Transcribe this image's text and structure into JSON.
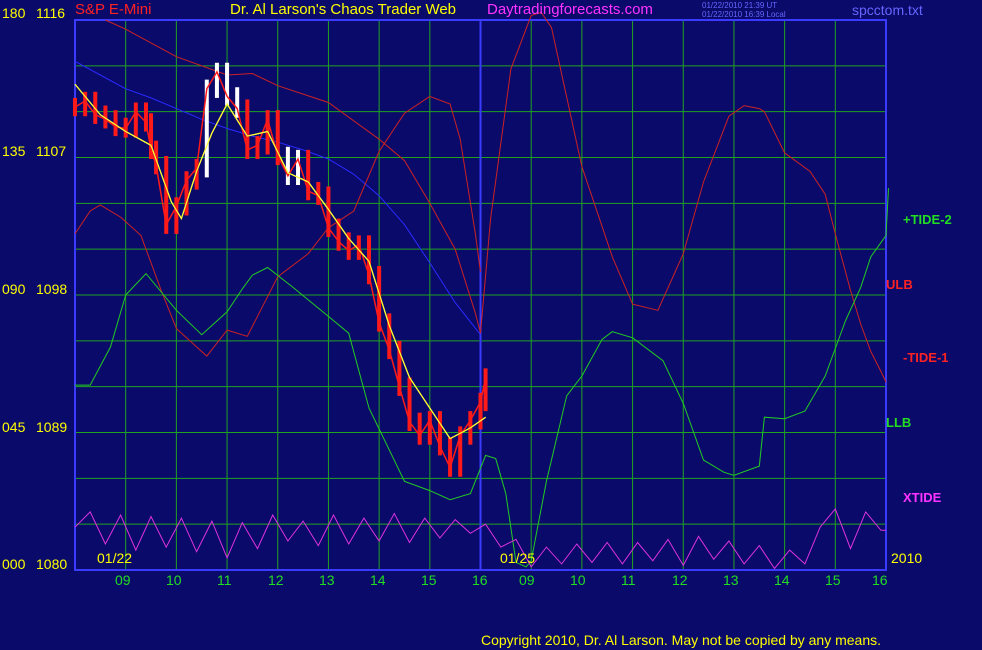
{
  "header": {
    "symbol": "S&P E-Mini",
    "title": "Dr. Al Larson's Chaos Trader Web",
    "site": "Daytradingforecasts.com",
    "time_ut": "01/22/2010 21:39 UT",
    "time_local": "01/22/2010 16:39 Local",
    "file": "spcctom.txt"
  },
  "footer": {
    "copyright": "Copyright 2010, Dr. Al Larson. May not be copied by any means."
  },
  "colors": {
    "background": "#0a0a6b",
    "grid": "#1fa31f",
    "divider": "#3b3bff",
    "price_down": "#ff1a1a",
    "price_up": "#ffffff",
    "avg": "#ffff33",
    "tide2": "#22cc22",
    "tide1": "#cc2222",
    "ulb": "#cc2222",
    "llb": "#22cc22",
    "xtide": "#dd33dd",
    "blue_line": "#2a2aff",
    "text_yellow": "#ffff00",
    "text_pink": "#ff33ff",
    "text_blue": "#6666ff",
    "text_red": "#ff2222",
    "text_green": "#22dd22"
  },
  "chart_data": {
    "type": "line",
    "y_left_osc": [
      "180",
      "135",
      "090",
      "045",
      "000"
    ],
    "y_left_price": [
      "1116",
      "1107",
      "1098",
      "1089",
      "1080"
    ],
    "price_range": [
      1080,
      1116
    ],
    "x_ticks": [
      "09",
      "10",
      "11",
      "12",
      "13",
      "14",
      "15",
      "16",
      "09",
      "10",
      "11",
      "12",
      "13",
      "14",
      "15",
      "16"
    ],
    "date_labels": [
      "01/22",
      "01/25"
    ],
    "year_label": "2010",
    "x_index_range": [
      0,
      16
    ],
    "series_labels": [
      "+TIDE-2",
      "ULB",
      "-TIDE-1",
      "LLB",
      "XTIDE"
    ],
    "series": [
      {
        "name": "price",
        "x": [
          0,
          0.2,
          0.4,
          0.6,
          0.8,
          1.0,
          1.2,
          1.4,
          1.5,
          1.6,
          1.8,
          2.0,
          2.2,
          2.4,
          2.6,
          2.8,
          3.0,
          3.2,
          3.4,
          3.6,
          3.8,
          4.0,
          4.2,
          4.4,
          4.6,
          4.8,
          5.0,
          5.2,
          5.4,
          5.6,
          5.8,
          6.0,
          6.2,
          6.4,
          6.6,
          6.8,
          7.0,
          7.2,
          7.4,
          7.6,
          7.8,
          8.0,
          8.1
        ],
        "y": [
          1110.3,
          1110.7,
          1109.8,
          1109.5,
          1109.0,
          1108.9,
          1110.0,
          1109.3,
          1107.5,
          1106.5,
          1102.6,
          1103.8,
          1105.5,
          1106.3,
          1111.5,
          1112.6,
          1111.0,
          1110.2,
          1107.5,
          1107.8,
          1109.5,
          1107.1,
          1105.8,
          1106.9,
          1104.8,
          1104.5,
          1102.4,
          1101.5,
          1100.9,
          1101.3,
          1099.3,
          1096.2,
          1094.4,
          1092.0,
          1089.7,
          1088.8,
          1089.8,
          1088.1,
          1086.7,
          1088.8,
          1089.8,
          1091.0,
          1092.6
        ]
      },
      {
        "name": "avg",
        "x": [
          0,
          0.5,
          1.0,
          1.5,
          1.9,
          2.1,
          2.4,
          2.7,
          3.0,
          3.4,
          3.8,
          4.2,
          4.6,
          5.0,
          5.4,
          5.8,
          6.2,
          6.6,
          7.0,
          7.4,
          7.8,
          8.1
        ],
        "y": [
          1111.8,
          1109.8,
          1108.7,
          1107.8,
          1104.1,
          1103.0,
          1106.1,
          1108.6,
          1110.5,
          1108.4,
          1108.7,
          1106.0,
          1105.4,
          1103.6,
          1101.7,
          1100.2,
          1096.0,
          1092.6,
          1090.6,
          1088.6,
          1089.3,
          1090.0
        ]
      },
      {
        "name": "blue",
        "x": [
          0,
          0.5,
          1.0,
          1.5,
          2.0,
          2.5,
          3.0,
          3.5,
          4.0,
          4.5,
          5.0,
          5.5,
          6.0,
          6.5,
          7.0,
          7.5,
          8.0
        ],
        "y": [
          1113.3,
          1112.4,
          1111.5,
          1110.9,
          1110.2,
          1109.5,
          1108.9,
          1108.4,
          1108.0,
          1107.5,
          1106.9,
          1105.9,
          1104.5,
          1102.6,
          1100.1,
          1097.5,
          1095.4
        ]
      },
      {
        "name": "ulb",
        "x": [
          0.6,
          1.0,
          2.0,
          3.0,
          3.5,
          4.0,
          5.0,
          6.0,
          6.5,
          7.0,
          7.5,
          7.9,
          8.0,
          8.2,
          8.6,
          9.0,
          9.2,
          9.4,
          10.0,
          10.6,
          11.0,
          11.5,
          12.0,
          12.4,
          12.9,
          13.2,
          13.5,
          13.6,
          14.0,
          14.5,
          14.8,
          15.0,
          15.3,
          15.5,
          15.7,
          15.9,
          16.0
        ],
        "y": [
          1116.0,
          1115.4,
          1113.6,
          1112.4,
          1112.5,
          1111.7,
          1110.6,
          1108.2,
          1106.8,
          1104.0,
          1101.0,
          1096.8,
          1095.5,
          1103.0,
          1112.8,
          1116.3,
          1116.5,
          1115.5,
          1106.4,
          1100.5,
          1097.4,
          1097.0,
          1100.7,
          1105.4,
          1109.7,
          1110.4,
          1110.2,
          1110.0,
          1107.3,
          1106.1,
          1104.6,
          1102.0,
          1098.3,
          1096.1,
          1094.3,
          1093.0,
          1092.3
        ]
      },
      {
        "name": "tide1",
        "x": [
          0,
          0.3,
          0.5,
          0.9,
          1.3,
          1.7,
          2.0,
          2.6,
          3.0,
          3.4,
          4.0,
          4.6,
          5.0,
          5.5,
          6.0,
          6.5,
          7.0,
          7.4,
          7.6,
          7.9,
          8.0
        ],
        "y": [
          1102.0,
          1103.5,
          1103.9,
          1103.1,
          1101.9,
          1098.3,
          1095.8,
          1094.0,
          1095.7,
          1095.3,
          1099.2,
          1100.7,
          1102.4,
          1103.5,
          1107.4,
          1109.9,
          1111.0,
          1110.5,
          1108.2,
          1102.0,
          1099.5
        ]
      },
      {
        "name": "tide2",
        "x": [
          0,
          0.3,
          0.7,
          1.0,
          1.4,
          2.0,
          2.5,
          3.0,
          3.3,
          3.5,
          3.8,
          4.3,
          5.0,
          5.4,
          5.8,
          6.5,
          7.0,
          7.4,
          7.8,
          8.1,
          8.3,
          8.5,
          8.7,
          8.9,
          9.0,
          9.3,
          9.7,
          10.0,
          10.4,
          10.6,
          11.0,
          11.6,
          12.0,
          12.4,
          12.8,
          13.0,
          13.5,
          13.6,
          14.0,
          14.4,
          14.8,
          15.2,
          15.5,
          15.7,
          16.0,
          16.05
        ],
        "y": [
          1092.1,
          1092.1,
          1094.6,
          1098.0,
          1099.4,
          1097.0,
          1095.4,
          1096.9,
          1098.4,
          1099.3,
          1099.8,
          1098.5,
          1096.6,
          1095.5,
          1090.6,
          1085.8,
          1085.2,
          1084.6,
          1085.0,
          1087.5,
          1087.3,
          1085.0,
          1080.5,
          1080.2,
          1080.6,
          1085.8,
          1091.4,
          1092.7,
          1095.1,
          1095.6,
          1095.2,
          1093.7,
          1090.9,
          1087.2,
          1086.4,
          1086.2,
          1086.8,
          1090.0,
          1089.9,
          1090.4,
          1092.7,
          1096.3,
          1098.5,
          1100.5,
          1101.9,
          1105.0
        ]
      },
      {
        "name": "xtide",
        "x": [
          0,
          0.3,
          0.6,
          0.9,
          1.2,
          1.5,
          1.8,
          2.1,
          2.4,
          2.7,
          3.0,
          3.3,
          3.6,
          3.9,
          4.2,
          4.5,
          4.8,
          5.1,
          5.4,
          5.7,
          6.0,
          6.3,
          6.6,
          6.9,
          7.2,
          7.5,
          7.8,
          8.1,
          8.4,
          8.7,
          9.0,
          9.3,
          9.6,
          9.9,
          10.2,
          10.5,
          10.8,
          11.1,
          11.4,
          11.7,
          12.0,
          12.3,
          12.6,
          12.9,
          13.2,
          13.5,
          13.8,
          14.1,
          14.4,
          14.7,
          15.0,
          15.3,
          15.6,
          15.9,
          16.0
        ],
        "y": [
          1082.8,
          1083.8,
          1081.7,
          1083.6,
          1081.3,
          1083.5,
          1081.5,
          1083.4,
          1081.2,
          1083.2,
          1080.8,
          1083.1,
          1081.4,
          1083.6,
          1081.9,
          1083.2,
          1081.6,
          1083.6,
          1081.7,
          1083.4,
          1081.9,
          1083.7,
          1081.8,
          1083.4,
          1082.1,
          1083.3,
          1082.4,
          1083.0,
          1081.5,
          1082.0,
          1080.2,
          1081.5,
          1080.4,
          1081.7,
          1080.5,
          1081.8,
          1080.4,
          1081.8,
          1080.6,
          1082.0,
          1080.3,
          1082.2,
          1080.7,
          1081.9,
          1080.4,
          1081.6,
          1080.1,
          1081.3,
          1080.4,
          1082.8,
          1084.0,
          1081.4,
          1083.8,
          1082.6,
          1082.6
        ]
      }
    ]
  }
}
